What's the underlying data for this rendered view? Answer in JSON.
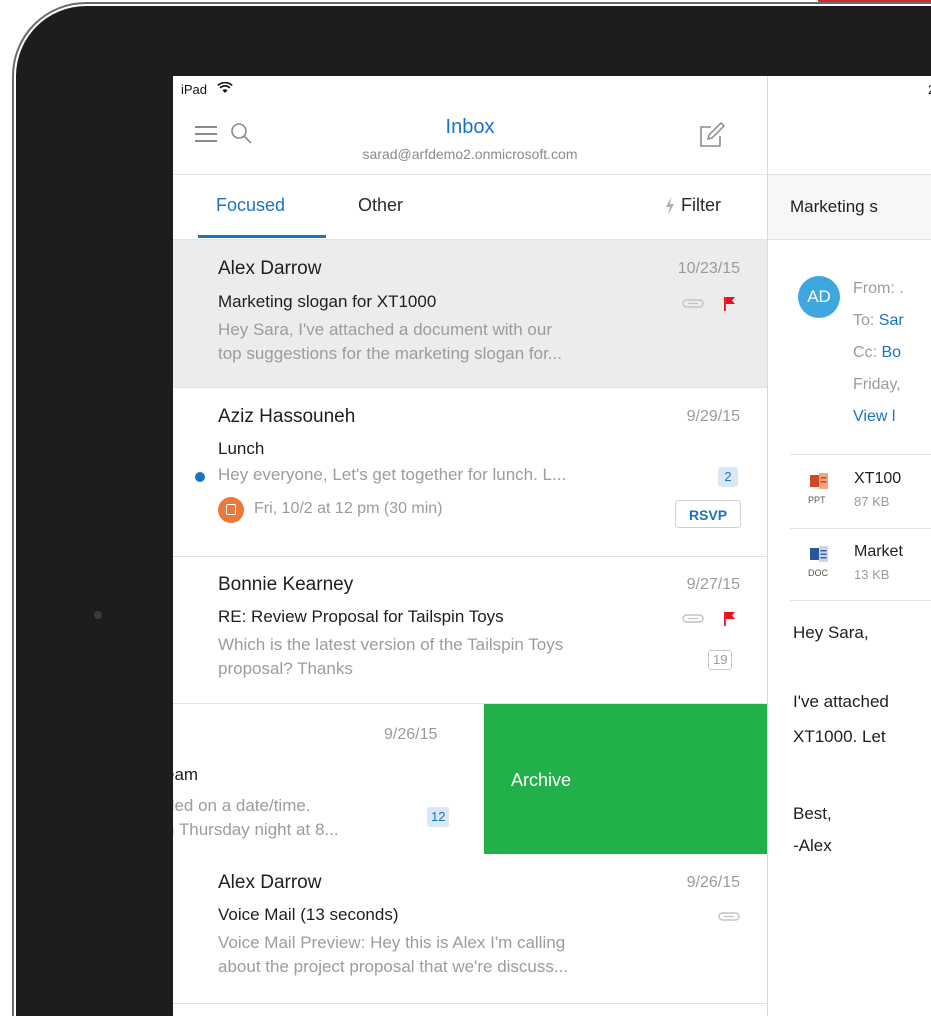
{
  "status_bar": {
    "device": "iPad",
    "time": "2"
  },
  "header": {
    "title": "Inbox",
    "account": "sarad@arfdemo2.onmicrosoft.com"
  },
  "tabs": {
    "focused": "Focused",
    "other": "Other",
    "filter": "Filter"
  },
  "messages": [
    {
      "sender": "Alex Darrow",
      "date": "10/23/15",
      "subject": "Marketing slogan for XT1000",
      "preview": [
        "Hey Sara, I've attached a document with our",
        "top suggestions for the marketing slogan for..."
      ]
    },
    {
      "sender": "Aziz Hassouneh",
      "date": "9/29/15",
      "subject": "Lunch",
      "preview": [
        "Hey everyone, Let's get together for lunch. L..."
      ],
      "count": "2",
      "event": "Fri, 10/2 at 12 pm (30 min)",
      "rsvp": "RSVP"
    },
    {
      "sender": "Bonnie Kearney",
      "date": "9/27/15",
      "subject": "RE: Review Proposal for Tailspin Toys",
      "preview": [
        "Which is the latest version of the Tailspin Toys",
        "proposal? Thanks"
      ],
      "count": "19"
    },
    {
      "date": "9/26/15",
      "subject": "eam",
      "preview": [
        "ded on a date/time.",
        "n Thursday night at 8..."
      ],
      "count": "12",
      "action": "Archive"
    },
    {
      "sender": "Alex Darrow",
      "date": "9/26/15",
      "subject": "Voice Mail (13 seconds)",
      "preview": [
        "Voice Mail Preview: Hey this is Alex I'm calling",
        "about the project proposal that we're discuss..."
      ]
    }
  ],
  "reading": {
    "subject": "Marketing s",
    "avatar": "AD",
    "from": "From: .",
    "to_label": "To: ",
    "to_name": "Sar",
    "cc_label": "Cc: ",
    "cc_name": "Bo",
    "date": "Friday,",
    "view_link": "View l",
    "attachments": [
      {
        "name": "XT100",
        "size": "87 KB",
        "ext": "PPT"
      },
      {
        "name": "Market",
        "size": "13 KB",
        "ext": "DOC"
      }
    ],
    "body": [
      "Hey Sara,",
      "I've attached",
      "XT1000. Let",
      "Best,",
      "-Alex"
    ]
  },
  "colors": {
    "accent": "#1a73c2",
    "archive": "#22b04b",
    "flag": "#e81123",
    "event": "#ea7a3a",
    "avatar": "#3fa7e0"
  }
}
